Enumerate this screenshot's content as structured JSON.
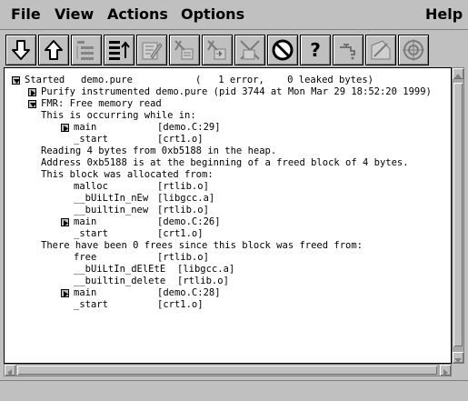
{
  "menubar": {
    "file": "File",
    "view": "View",
    "actions": "Actions",
    "options": "Options",
    "help": "Help"
  },
  "toolbar": {
    "buttons": [
      {
        "icon": "arrow-down-icon"
      },
      {
        "icon": "arrow-up-icon"
      },
      {
        "icon": "collapse-list-icon"
      },
      {
        "icon": "expand-list-icon"
      },
      {
        "icon": "edit-icon"
      },
      {
        "icon": "suppress-icon"
      },
      {
        "icon": "unsuppress-icon"
      },
      {
        "icon": "kill-icon"
      },
      {
        "icon": "no-entry-icon"
      },
      {
        "icon": "help-question-icon"
      },
      {
        "icon": "faucet-leak-icon"
      },
      {
        "icon": "new-leaks-icon"
      },
      {
        "icon": "coverage-target-icon"
      }
    ],
    "help_symbol": "?"
  },
  "log": {
    "started_label": "Started",
    "started_program": "demo.pure",
    "started_summary": "(   1 error,    0 leaked bytes)",
    "purify_line": "Purify instrumented demo.pure (pid 3744 at Mon Mar 29 18:52:20 1999)",
    "fmr_line": "FMR: Free memory read",
    "occurring": "This is occurring while in:",
    "stack1": [
      {
        "func": "main",
        "loc": "[demo.C:29]"
      },
      {
        "func": "_start",
        "loc": "[crt1.o]"
      }
    ],
    "reading": "Reading 4 bytes from 0xb5188 in the heap.",
    "address": "Address 0xb5188 is at the beginning of a freed block of 4 bytes.",
    "allocated": "This block was allocated from:",
    "stack2": [
      {
        "func": "malloc",
        "loc": "[rtlib.o]"
      },
      {
        "func": "__bUiLtIn_nEw",
        "loc": "[libgcc.a]"
      },
      {
        "func": "__builtin_new",
        "loc": "[rtlib.o]"
      },
      {
        "func": "main",
        "loc": "[demo.C:26]"
      },
      {
        "func": "_start",
        "loc": "[crt1.o]"
      }
    ],
    "freed": "There have been 0 frees since this block was freed from:",
    "stack3": [
      {
        "func": "free",
        "loc": "[rtlib.o]"
      },
      {
        "func": "__bUiLtIn_dElEtE",
        "loc": "[libgcc.a]"
      },
      {
        "func": "__builtin_delete",
        "loc": "[rtlib.o]"
      },
      {
        "func": "main",
        "loc": "[demo.C:28]"
      },
      {
        "func": "_start",
        "loc": "[crt1.o]"
      }
    ]
  }
}
